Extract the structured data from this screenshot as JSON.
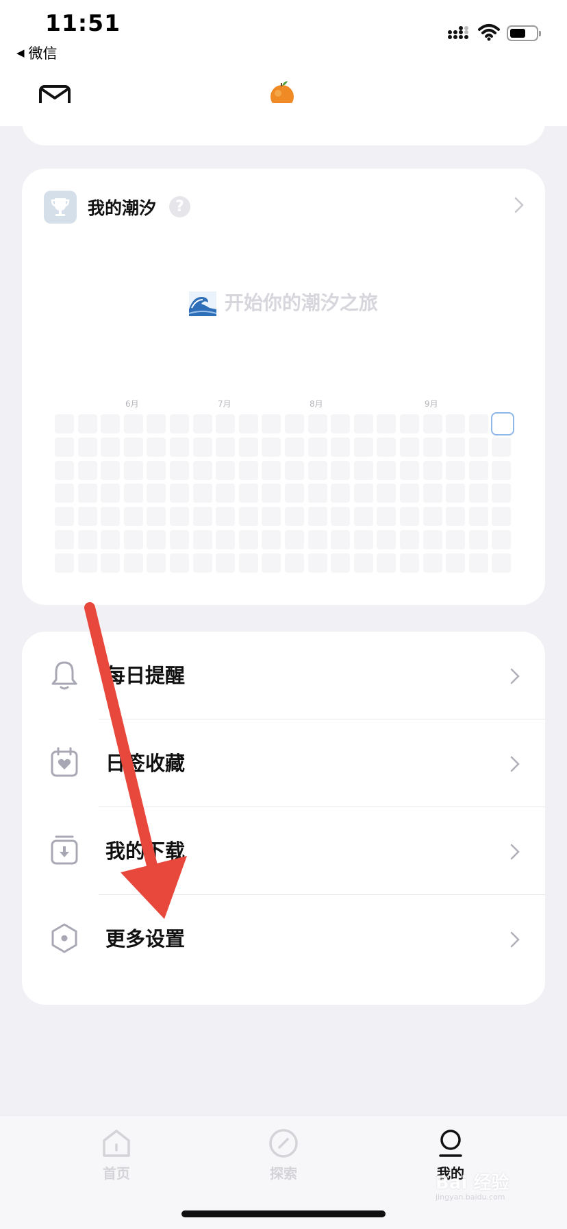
{
  "status_bar": {
    "time": "11:51",
    "back_app": "微信"
  },
  "header": {
    "left_icon": "mail-icon",
    "logo_icon": "orange-icon"
  },
  "tide_card": {
    "title": "我的潮汐",
    "help": "?",
    "cta": "开始你的潮汐之旅",
    "cta_icon": "wave-icon",
    "months": [
      "6月",
      "7月",
      "8月",
      "9月"
    ],
    "grid_weeks": 20,
    "grid_days": 7
  },
  "menu": {
    "items": [
      {
        "label": "每日提醒",
        "icon": "bell-icon"
      },
      {
        "label": "日签收藏",
        "icon": "calendar-heart-icon"
      },
      {
        "label": "我的下载",
        "icon": "download-box-icon"
      },
      {
        "label": "更多设置",
        "icon": "settings-hexagon-icon"
      }
    ]
  },
  "tabs": [
    {
      "label": "首页",
      "icon": "home-icon",
      "active": false
    },
    {
      "label": "探索",
      "icon": "compass-icon",
      "active": false
    },
    {
      "label": "我的",
      "icon": "profile-icon",
      "active": true
    }
  ],
  "watermark": {
    "text": "Bai 经验",
    "sub": "jingyan.baidu.com"
  },
  "colors": {
    "background": "#f1f1f5",
    "card": "#ffffff",
    "annotation_arrow": "#e8473c",
    "today_outline": "#8fb6e8"
  }
}
